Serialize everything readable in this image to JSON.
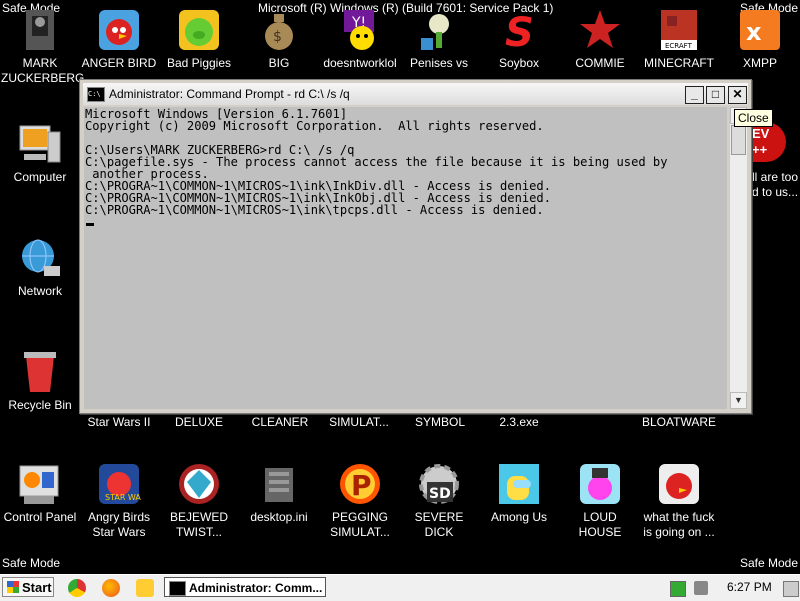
{
  "safe_mode": {
    "tl": "Safe Mode",
    "tr": "Safe Mode",
    "bl": "Safe Mode",
    "br": "Safe Mode"
  },
  "desktop_title": "Microsoft (R) Windows (R) (Build 7601: Service Pack 1)",
  "icons": {
    "mark": "MARK ZUCKERBERG",
    "anger": "ANGER BIRD",
    "piggies": "Bad Piggies",
    "big": "BIG",
    "doesnt": "doesntworklol",
    "penises": "Penises vs",
    "soybox": "Soybox",
    "commie": "COMMIE",
    "minecraft": "MINECRAFT",
    "xmpp": "XMPP",
    "computer": "Computer",
    "network": "Network",
    "recycle": "Recycle Bin",
    "control": "Control Panel",
    "angry_sw": "Angry Birds Star Wars",
    "bejewed": "BEJEWED TWIST...",
    "desktopini": "desktop.ini",
    "pegging": "PEGGING SIMULAT...",
    "severe": "SEVERE DICK",
    "among": "Among Us",
    "loud": "LOUD HOUSE",
    "wtf": "what the fuck is going on ..."
  },
  "row2_labels": {
    "starwars": "Star Wars II",
    "deluxe": "DELUXE",
    "cleaner": "CLEANER",
    "simulat": "SIMULAT...",
    "symbol": "SYMBOL",
    "exe": "2.3.exe",
    "bloatware": "BLOATWARE"
  },
  "partial_icon": {
    "badge": "EV ++",
    "text": "ll are too d to us..."
  },
  "window": {
    "icon_text": "C:\\",
    "title": "Administrator: Command Prompt - rd  C:\\ /s /q",
    "minimize": "_",
    "maximize": "□",
    "close": "✕",
    "console_lines": [
      "Microsoft Windows [Version 6.1.7601]",
      "Copyright (c) 2009 Microsoft Corporation.  All rights reserved.",
      "",
      "C:\\Users\\MARK ZUCKERBERG>rd C:\\ /s /q",
      "C:\\pagefile.sys - The process cannot access the file because it is being used by",
      " another process.",
      "C:\\PROGRA~1\\COMMON~1\\MICROS~1\\ink\\InkDiv.dll - Access is denied.",
      "C:\\PROGRA~1\\COMMON~1\\MICROS~1\\ink\\InkObj.dll - Access is denied.",
      "C:\\PROGRA~1\\COMMON~1\\MICROS~1\\ink\\tpcps.dll - Access is denied."
    ]
  },
  "tooltip": "Close",
  "taskbar": {
    "start": "Start",
    "task_item": "Administrator: Comm...",
    "clock": "6:27 PM"
  }
}
